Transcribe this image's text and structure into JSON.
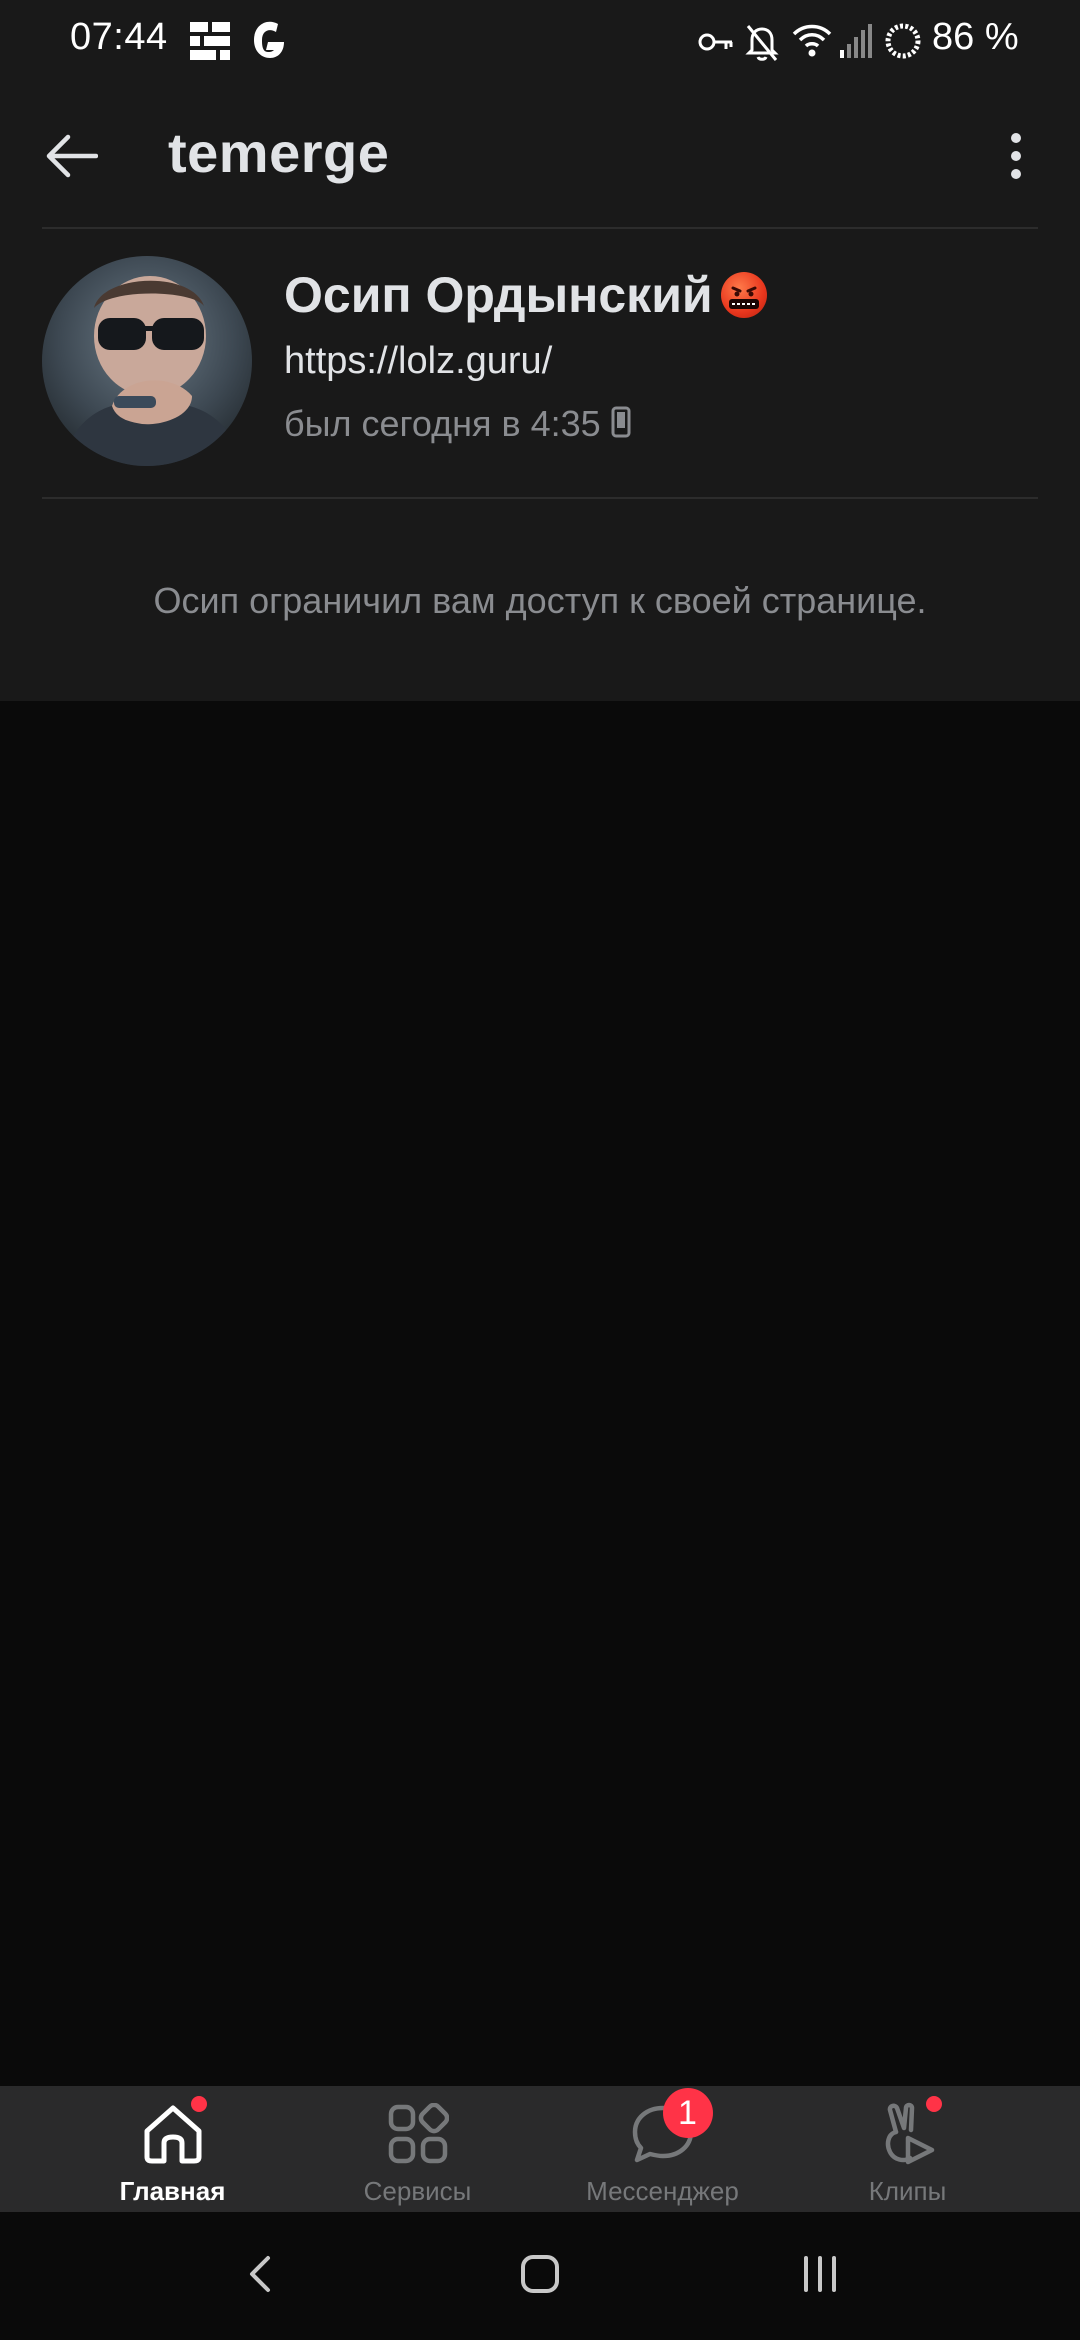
{
  "status_bar": {
    "time": "07:44",
    "battery_text": "86 %",
    "left_icons": [
      "grid-app-icon",
      "g-app-icon"
    ],
    "right_icons": [
      "key-icon",
      "bell-off-icon",
      "wifi-icon",
      "signal-icon",
      "battery-ring-icon"
    ]
  },
  "app_bar": {
    "title": "temerge",
    "back_icon": "arrow-left-icon",
    "menu_icon": "more-vertical-icon"
  },
  "profile": {
    "name": "Осип Ордынский",
    "status_emoji": "angry-face-emoji",
    "link": "https://lolz.guru/",
    "last_seen": "был сегодня в 4:35",
    "device_icon": "phone-icon"
  },
  "restricted_message": "Осип ограничил вам доступ к своей странице.",
  "bottom_nav": {
    "items": [
      {
        "label": "Главная",
        "icon": "home-icon",
        "active": true,
        "dot": true
      },
      {
        "label": "Сервисы",
        "icon": "services-icon",
        "active": false
      },
      {
        "label": "Мессенджер",
        "icon": "messenger-icon",
        "active": false,
        "badge": "1"
      },
      {
        "label": "Клипы",
        "icon": "clips-icon",
        "active": false,
        "dot": true
      }
    ]
  },
  "system_nav": {
    "buttons": [
      "back-chevron-icon",
      "home-square-icon",
      "recents-icon"
    ]
  },
  "colors": {
    "background": "#0a0a0a",
    "card": "#191919",
    "nav_bar": "#2a2a2b",
    "badge": "#ff3347",
    "primary_text": "#e1e3e6",
    "secondary_text": "#8a8c90"
  }
}
